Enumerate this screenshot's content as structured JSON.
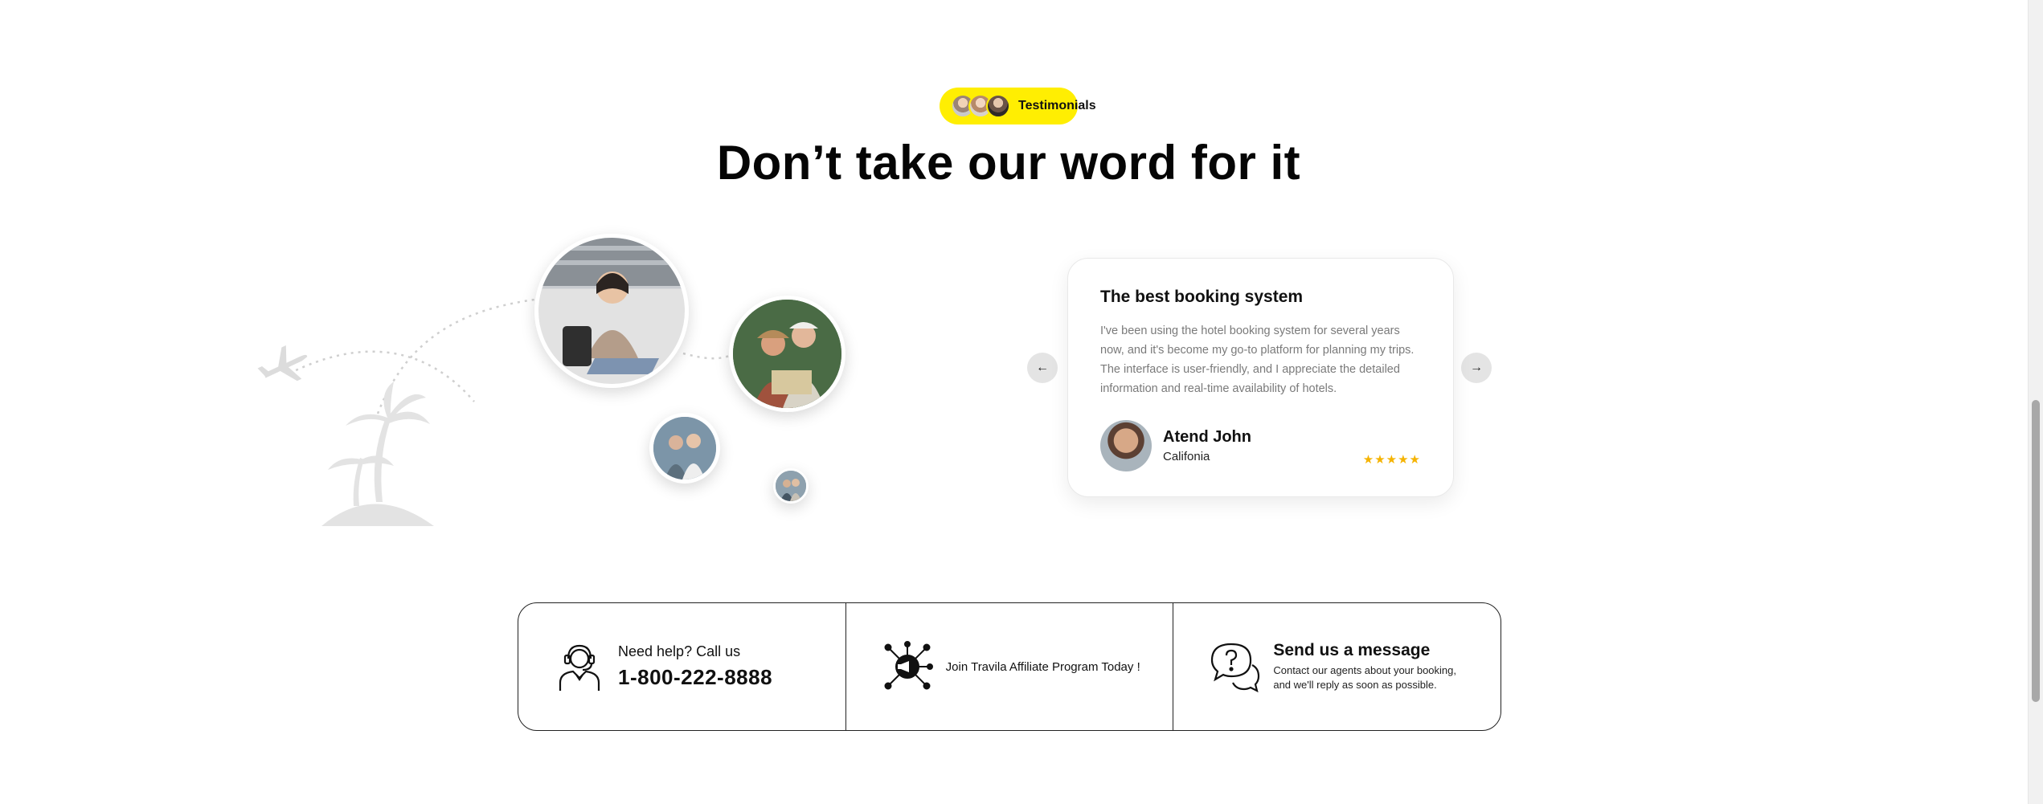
{
  "badge": {
    "label": "Testimonials"
  },
  "headline": "Don’t take our word for it",
  "testimonial": {
    "title": "The best booking system",
    "quote": "I've been using the hotel booking system for several years now, and it's become my go-to platform for planning my trips. The interface is user-friendly, and I appreciate the detailed information and real-time availability of hotels.",
    "author": "Atend John",
    "location": "Califonia",
    "rating": 5,
    "stars": "★★★★★"
  },
  "nav": {
    "prev_icon": "←",
    "next_icon": "→"
  },
  "contact": {
    "call_label": "Need help? Call us",
    "phone": "1-800-222-8888",
    "affiliate": "Join Travila Affiliate Program Today !",
    "message_title": "Send us a message",
    "message_text": "Contact our agents about your booking, and we'll reply as soon as possible."
  },
  "colors": {
    "accent": "#ffee02",
    "star": "#f5b301",
    "text": "#111111"
  },
  "icons": [
    "headset-agent-icon",
    "megaphone-network-icon",
    "chat-question-icon",
    "plane-icon",
    "palm-island-icon"
  ]
}
